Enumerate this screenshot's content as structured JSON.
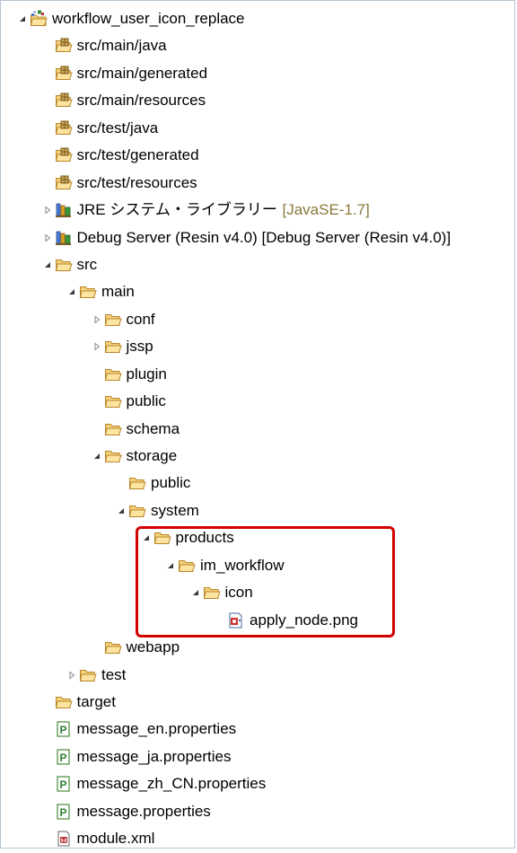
{
  "tree": {
    "items": [
      {
        "label": "workflow_user_icon_replace",
        "icon": "project-icon",
        "depth": 0,
        "twisty": "expanded"
      },
      {
        "label": "src/main/java",
        "icon": "package-folder-icon",
        "depth": 1,
        "twisty": "none"
      },
      {
        "label": "src/main/generated",
        "icon": "package-folder-icon",
        "depth": 1,
        "twisty": "none"
      },
      {
        "label": "src/main/resources",
        "icon": "package-folder-icon",
        "depth": 1,
        "twisty": "none"
      },
      {
        "label": "src/test/java",
        "icon": "package-folder-icon",
        "depth": 1,
        "twisty": "none"
      },
      {
        "label": "src/test/generated",
        "icon": "package-folder-icon",
        "depth": 1,
        "twisty": "none"
      },
      {
        "label": "src/test/resources",
        "icon": "package-folder-icon",
        "depth": 1,
        "twisty": "none"
      },
      {
        "label": "JRE システム・ライブラリー",
        "decoration": "[JavaSE-1.7]",
        "icon": "library-icon",
        "depth": 1,
        "twisty": "collapsed"
      },
      {
        "label": "Debug Server (Resin v4.0) [Debug Server (Resin v4.0)]",
        "icon": "library-icon",
        "depth": 1,
        "twisty": "collapsed"
      },
      {
        "label": "src",
        "icon": "folder-icon",
        "depth": 1,
        "twisty": "expanded"
      },
      {
        "label": "main",
        "icon": "folder-icon",
        "depth": 2,
        "twisty": "expanded"
      },
      {
        "label": "conf",
        "icon": "folder-icon",
        "depth": 3,
        "twisty": "collapsed"
      },
      {
        "label": "jssp",
        "icon": "folder-icon",
        "depth": 3,
        "twisty": "collapsed"
      },
      {
        "label": "plugin",
        "icon": "folder-icon",
        "depth": 3,
        "twisty": "none"
      },
      {
        "label": "public",
        "icon": "folder-icon",
        "depth": 3,
        "twisty": "none"
      },
      {
        "label": "schema",
        "icon": "folder-icon",
        "depth": 3,
        "twisty": "none"
      },
      {
        "label": "storage",
        "icon": "folder-icon",
        "depth": 3,
        "twisty": "expanded"
      },
      {
        "label": "public",
        "icon": "folder-icon",
        "depth": 4,
        "twisty": "none"
      },
      {
        "label": "system",
        "icon": "folder-icon",
        "depth": 4,
        "twisty": "expanded"
      },
      {
        "label": "products",
        "icon": "folder-icon",
        "depth": 5,
        "twisty": "expanded"
      },
      {
        "label": "im_workflow",
        "icon": "folder-icon",
        "depth": 6,
        "twisty": "expanded"
      },
      {
        "label": "icon",
        "icon": "folder-icon",
        "depth": 7,
        "twisty": "expanded"
      },
      {
        "label": "apply_node.png",
        "icon": "image-file-icon",
        "depth": 8,
        "twisty": "none"
      },
      {
        "label": "webapp",
        "icon": "folder-icon",
        "depth": 3,
        "twisty": "none"
      },
      {
        "label": "test",
        "icon": "folder-icon",
        "depth": 2,
        "twisty": "collapsed"
      },
      {
        "label": "target",
        "icon": "folder-icon",
        "depth": 1,
        "twisty": "none"
      },
      {
        "label": "message_en.properties",
        "icon": "properties-file-icon",
        "depth": 1,
        "twisty": "none"
      },
      {
        "label": "message_ja.properties",
        "icon": "properties-file-icon",
        "depth": 1,
        "twisty": "none"
      },
      {
        "label": "message_zh_CN.properties",
        "icon": "properties-file-icon",
        "depth": 1,
        "twisty": "none"
      },
      {
        "label": "message.properties",
        "icon": "properties-file-icon",
        "depth": 1,
        "twisty": "none"
      },
      {
        "label": "module.xml",
        "icon": "xml-file-icon",
        "depth": 1,
        "twisty": "none"
      }
    ]
  },
  "colors": {
    "folder": "#e8b64a",
    "highlight": "#d40000",
    "decoration": "#8b7a3b"
  }
}
